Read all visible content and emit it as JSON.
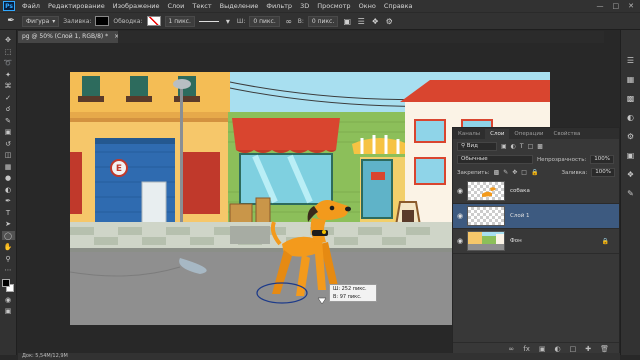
{
  "menu": {
    "logo": "Ps",
    "items": [
      "Файл",
      "Редактирование",
      "Изображение",
      "Слои",
      "Текст",
      "Выделение",
      "Фильтр",
      "3D",
      "Просмотр",
      "Окно",
      "Справка"
    ]
  },
  "options_bar": {
    "tool_mode": "Фигура",
    "fill_label": "Заливка:",
    "stroke_label": "Обводка:",
    "stroke_width": "1 пикс.",
    "width_label": "Ш:",
    "width_value": "0 пикс.",
    "height_label": "В:",
    "height_value": "0 пикс.",
    "fill_color": "#000000"
  },
  "document": {
    "tab_title": "pg @ 50% (Слой 1, RGB/8) *"
  },
  "tooltip": {
    "width_line": "Ш: 252 пикс.",
    "height_line": "В: 97 пикс."
  },
  "layers_panel": {
    "tabs": [
      "Каналы",
      "Слои",
      "Операции",
      "Свойства"
    ],
    "active_tab": "Слои",
    "search_kind": "Вид",
    "blend_mode": "Обычные",
    "opacity_label": "Непрозрачность:",
    "opacity_value": "100%",
    "lock_label": "Закрепить:",
    "fill_label": "Заливка:",
    "fill_value": "100%",
    "layers": [
      {
        "name": "собака",
        "visible": true,
        "selected": false,
        "locked": false
      },
      {
        "name": "Слой 1",
        "visible": true,
        "selected": true,
        "locked": false
      },
      {
        "name": "Фон",
        "visible": true,
        "selected": false,
        "locked": true
      }
    ]
  },
  "status_bar": {
    "text": "Док: 5,54М/12,9М"
  },
  "colors": {
    "accent": "#31a8ff",
    "selected_layer": "#3d5a80",
    "dog": "#f39a1c",
    "sky": "#a8dff0"
  }
}
